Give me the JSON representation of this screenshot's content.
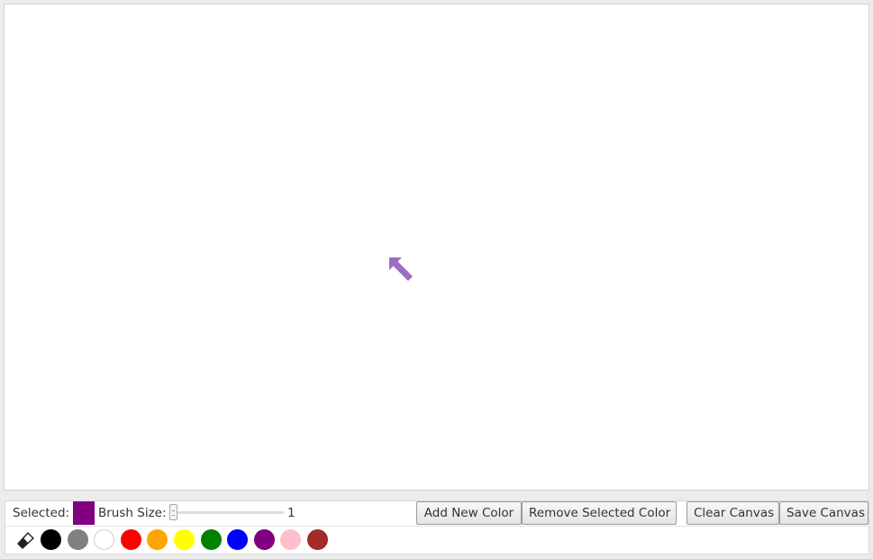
{
  "canvas": {
    "cursor_icon": "arrow-up-left-icon",
    "cursor_color": "#9b6fbf"
  },
  "toolbar": {
    "selected_label": "Selected:",
    "selected_color": "#800080",
    "brush_size_label": "Brush Size:",
    "brush_size_value": "1",
    "brush_size_fraction": 0.0,
    "add_color_label": "Add New Color",
    "remove_color_label": "Remove Selected Color",
    "clear_canvas_label": "Clear Canvas",
    "save_canvas_label": "Save Canvas"
  },
  "palette": {
    "eraser_icon": "eraser-icon",
    "colors": [
      {
        "name": "black",
        "hex": "#000000"
      },
      {
        "name": "gray",
        "hex": "#808080"
      },
      {
        "name": "white",
        "hex": "#ffffff"
      },
      {
        "name": "red",
        "hex": "#ff0000"
      },
      {
        "name": "orange",
        "hex": "#ffa500"
      },
      {
        "name": "yellow",
        "hex": "#ffff00"
      },
      {
        "name": "green",
        "hex": "#008000"
      },
      {
        "name": "blue",
        "hex": "#0000ff"
      },
      {
        "name": "purple",
        "hex": "#800080"
      },
      {
        "name": "pink",
        "hex": "#ffc0cb"
      },
      {
        "name": "brown",
        "hex": "#a52a2a"
      }
    ]
  }
}
